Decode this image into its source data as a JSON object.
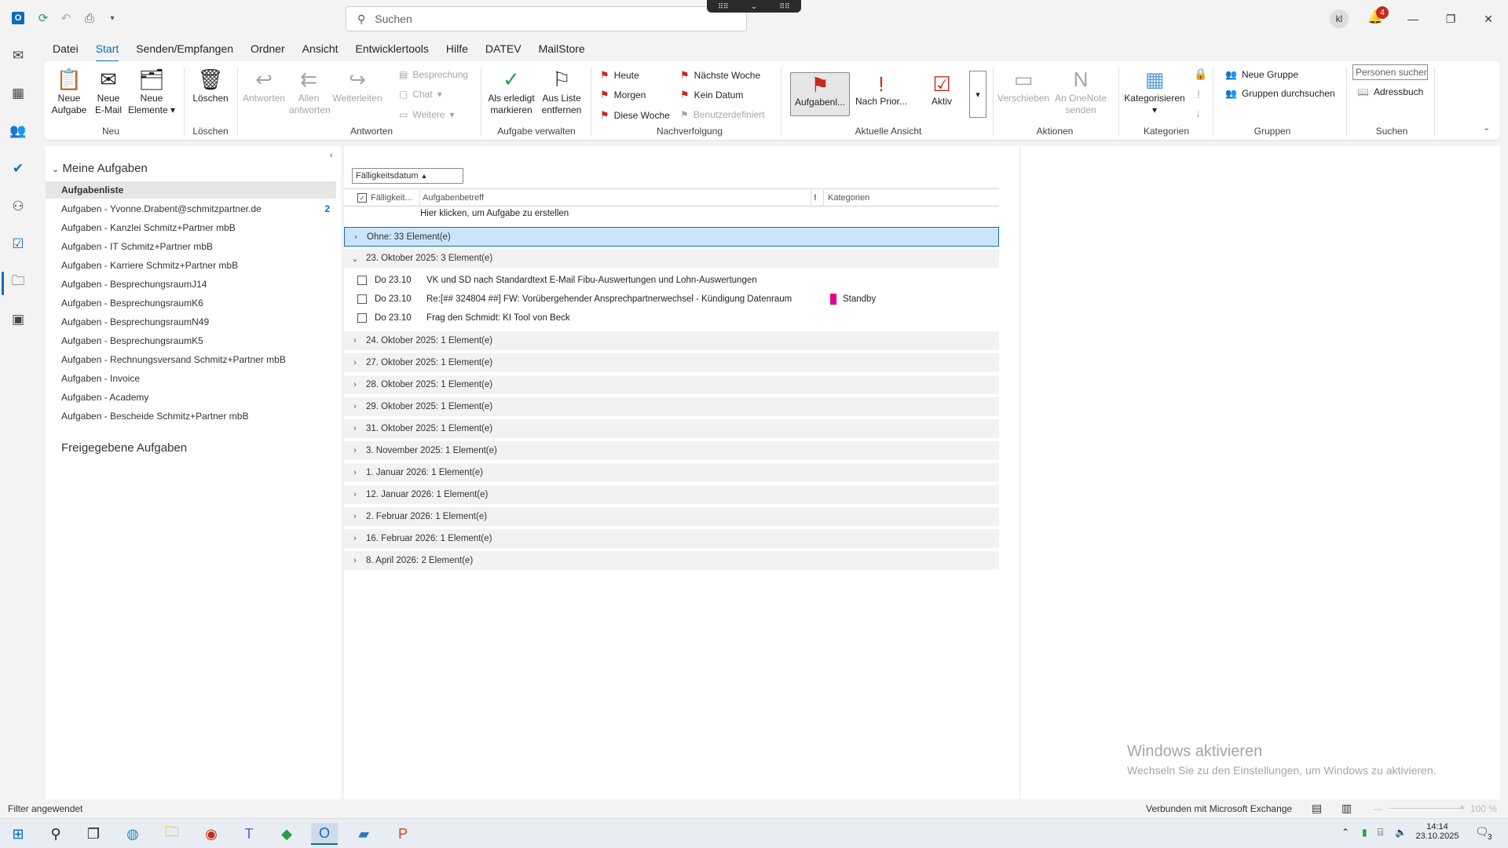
{
  "title_bar": {
    "search_placeholder": "Suchen",
    "avatar_initials": "kl",
    "notification_count": "4"
  },
  "menu": [
    "Datei",
    "Start",
    "Senden/Empfangen",
    "Ordner",
    "Ansicht",
    "Entwicklertools",
    "Hilfe",
    "DATEV",
    "MailStore"
  ],
  "ribbon": {
    "neu": {
      "neue_aufgabe": "Neue Aufgabe",
      "neue_email": "Neue E-Mail",
      "neue_elemente": "Neue Elemente",
      "group": "Neu"
    },
    "loeschen": {
      "loeschen": "Löschen",
      "group": "Löschen"
    },
    "antworten": {
      "antworten": "Antworten",
      "allen_antworten": "Allen antworten",
      "weiterleiten": "Weiterleiten",
      "besprechung": "Besprechung",
      "chat": "Chat",
      "weitere": "Weitere",
      "group": "Antworten"
    },
    "aufgabe_verwalten": {
      "erledigt": "Als erledigt markieren",
      "entfernen": "Aus Liste entfernen",
      "group": "Aufgabe verwalten"
    },
    "nachverfolgung": {
      "heute": "Heute",
      "morgen": "Morgen",
      "diese_woche": "Diese Woche",
      "naechste_woche": "Nächste Woche",
      "kein_datum": "Kein Datum",
      "benutzerdefiniert": "Benutzerdefiniert",
      "group": "Nachverfolgung"
    },
    "ansicht": {
      "aufgabenliste": "Aufgabenl...",
      "nach_prioritaet": "Nach Prior...",
      "aktiv": "Aktiv",
      "group": "Aktuelle Ansicht"
    },
    "aktionen": {
      "verschieben": "Verschieben",
      "onenote": "An OneNote senden",
      "group": "Aktionen"
    },
    "kategorien": {
      "kategorisieren": "Kategorisieren",
      "group": "Kategorien"
    },
    "gruppen": {
      "neue_gruppe": "Neue Gruppe",
      "durchsuchen": "Gruppen durchsuchen",
      "group": "Gruppen"
    },
    "suchen": {
      "personen": "Personen suchen",
      "adressbuch": "Adressbuch",
      "group": "Suchen"
    }
  },
  "folders": {
    "header": "Meine Aufgaben",
    "items": [
      {
        "label": "Aufgabenliste",
        "count": ""
      },
      {
        "label": "Aufgaben - Yvonne.Drabent@schmitzpartner.de",
        "count": "2"
      },
      {
        "label": "Aufgaben - Kanzlei Schmitz+Partner mbB",
        "count": ""
      },
      {
        "label": "Aufgaben - IT Schmitz+Partner mbB",
        "count": ""
      },
      {
        "label": "Aufgaben - Karriere Schmitz+Partner mbB",
        "count": ""
      },
      {
        "label": "Aufgaben - BesprechungsraumJ14",
        "count": ""
      },
      {
        "label": "Aufgaben - BesprechungsraumK6",
        "count": ""
      },
      {
        "label": "Aufgaben - BesprechungsraumN49",
        "count": ""
      },
      {
        "label": "Aufgaben - BesprechungsraumK5",
        "count": ""
      },
      {
        "label": "Aufgaben - Rechnungsversand Schmitz+Partner mbB",
        "count": ""
      },
      {
        "label": "Aufgaben - Invoice",
        "count": ""
      },
      {
        "label": "Aufgaben - Academy",
        "count": ""
      },
      {
        "label": "Aufgaben - Bescheide Schmitz+Partner mbB",
        "count": ""
      }
    ],
    "shared_header": "Freigegebene Aufgaben"
  },
  "list": {
    "sort_label": "Fälligkeitsdatum",
    "col_due": "Fälligkeit...",
    "col_subject": "Aufgabenbetreff",
    "col_priority": "!",
    "col_categories": "Kategorien",
    "new_task_hint": "Hier klicken, um Aufgabe zu erstellen",
    "groups": [
      {
        "label": "Ohne: 33 Element(e)",
        "expanded": false,
        "selected": true
      },
      {
        "label": "23. Oktober 2025: 3 Element(e)",
        "expanded": true,
        "selected": false
      },
      {
        "label": "24. Oktober 2025: 1 Element(e)",
        "expanded": false,
        "selected": false
      },
      {
        "label": "27. Oktober 2025: 1 Element(e)",
        "expanded": false,
        "selected": false
      },
      {
        "label": "28. Oktober 2025: 1 Element(e)",
        "expanded": false,
        "selected": false
      },
      {
        "label": "29. Oktober 2025: 1 Element(e)",
        "expanded": false,
        "selected": false
      },
      {
        "label": "31. Oktober 2025: 1 Element(e)",
        "expanded": false,
        "selected": false
      },
      {
        "label": "3. November 2025: 1 Element(e)",
        "expanded": false,
        "selected": false
      },
      {
        "label": "1. Januar 2026: 1 Element(e)",
        "expanded": false,
        "selected": false
      },
      {
        "label": "12. Januar 2026: 1 Element(e)",
        "expanded": false,
        "selected": false
      },
      {
        "label": "2. Februar 2026: 1 Element(e)",
        "expanded": false,
        "selected": false
      },
      {
        "label": "16. Februar 2026: 1 Element(e)",
        "expanded": false,
        "selected": false
      },
      {
        "label": "8. April 2026: 2 Element(e)",
        "expanded": false,
        "selected": false
      }
    ],
    "tasks": [
      {
        "due": "Do 23.10",
        "subject": "VK und SD nach Standardtext E-Mail Fibu-Auswertungen und Lohn-Auswertungen",
        "category": "",
        "category_color": ""
      },
      {
        "due": "Do 23.10",
        "subject": "Re:[## 324804 ##] FW: Vorübergehender Ansprechpartnerwechsel - Kündigung Datenraum",
        "category": "Standby",
        "category_color": "#e3008c"
      },
      {
        "due": "Do 23.10",
        "subject": "Frag den Schmidt: KI Tool von Beck",
        "category": "",
        "category_color": ""
      }
    ]
  },
  "watermark": {
    "title": "Windows aktivieren",
    "subtitle": "Wechseln Sie zu den Einstellungen, um Windows zu aktivieren."
  },
  "status": {
    "left": "Filter angewendet",
    "connection": "Verbunden mit Microsoft Exchange",
    "zoom": "100 %"
  },
  "taskbar": {
    "time": "14:14",
    "date": "23.10.2025",
    "notifications": "3"
  },
  "colors": {
    "accent": "#0f6cbd",
    "flag": "#c42b1c",
    "selected_group": "#cce4f7"
  }
}
